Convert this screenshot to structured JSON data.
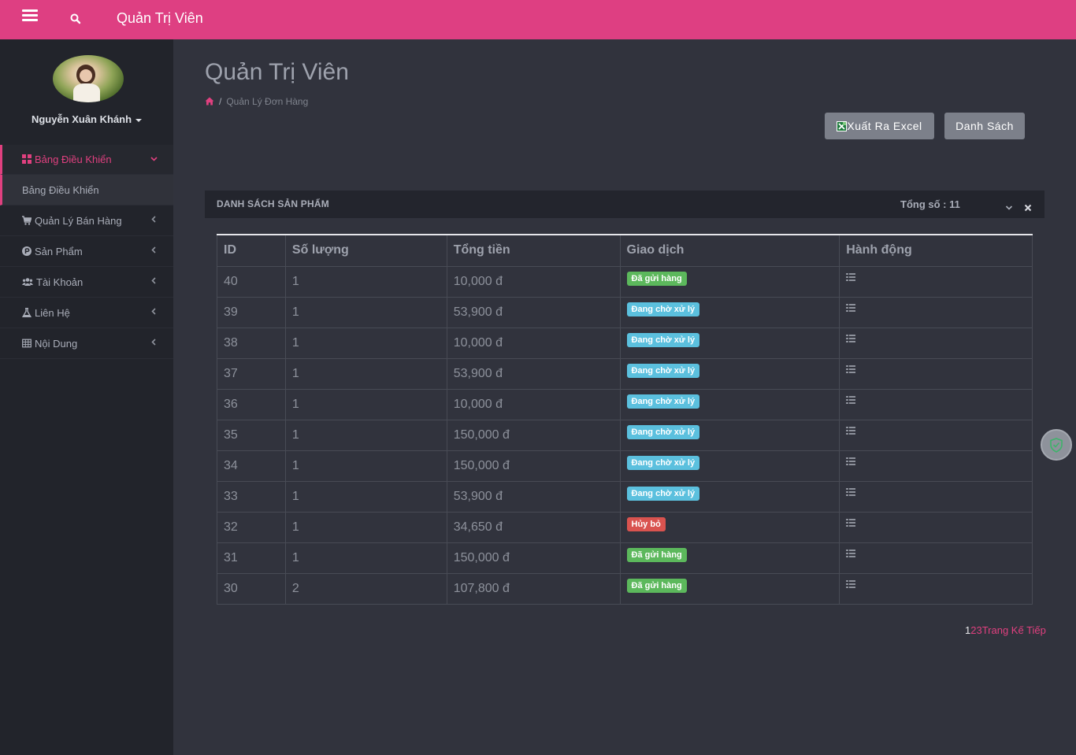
{
  "topbar": {
    "brand": "Quản Trị Viên",
    "menu_icon": "bars-icon",
    "search_icon": "search-icon",
    "color": "#de3f82"
  },
  "sidebar": {
    "username": "Nguyễn Xuân Khánh",
    "items": [
      {
        "label": "Bảng Điều Khiển",
        "icon": "th-large-icon",
        "active": true
      },
      {
        "label": "Bảng Điều Khiển",
        "sub": true
      },
      {
        "label": "Quản Lý Bán Hàng",
        "icon": "cart-icon"
      },
      {
        "label": "Sản Phẩm",
        "icon": "product-hunt-icon"
      },
      {
        "label": "Tài Khoản",
        "icon": "users-icon"
      },
      {
        "label": "Liên Hệ",
        "icon": "flask-icon"
      },
      {
        "label": "Nội Dung",
        "icon": "table-icon"
      }
    ]
  },
  "main": {
    "title": "Quản Trị Viên",
    "breadcrumb": {
      "separator": "/",
      "current": "Quản Lý Đơn Hàng"
    },
    "buttons": {
      "excel": "Xuất Ra Excel",
      "list": "Danh Sách"
    },
    "panel": {
      "title": "DANH SÁCH SẢN PHẨM",
      "total": "Tổng số : 11"
    },
    "table": {
      "headers": [
        "ID",
        "Số lượng",
        "Tổng tiền",
        "Giao dịch",
        "Hành động"
      ],
      "rows": [
        {
          "id": "40",
          "qty": "1",
          "total": "10,000 đ",
          "status": "Đã gửi hàng",
          "status_type": "sent"
        },
        {
          "id": "39",
          "qty": "1",
          "total": "53,900 đ",
          "status": "Đang chờ xử lý",
          "status_type": "wait"
        },
        {
          "id": "38",
          "qty": "1",
          "total": "10,000 đ",
          "status": "Đang chờ xử lý",
          "status_type": "wait"
        },
        {
          "id": "37",
          "qty": "1",
          "total": "53,900 đ",
          "status": "Đang chờ xử lý",
          "status_type": "wait"
        },
        {
          "id": "36",
          "qty": "1",
          "total": "10,000 đ",
          "status": "Đang chờ xử lý",
          "status_type": "wait"
        },
        {
          "id": "35",
          "qty": "1",
          "total": "150,000 đ",
          "status": "Đang chờ xử lý",
          "status_type": "wait"
        },
        {
          "id": "34",
          "qty": "1",
          "total": "150,000 đ",
          "status": "Đang chờ xử lý",
          "status_type": "wait"
        },
        {
          "id": "33",
          "qty": "1",
          "total": "53,900 đ",
          "status": "Đang chờ xử lý",
          "status_type": "wait"
        },
        {
          "id": "32",
          "qty": "1",
          "total": "34,650 đ",
          "status": "Hủy bỏ",
          "status_type": "cancel"
        },
        {
          "id": "31",
          "qty": "1",
          "total": "150,000 đ",
          "status": "Đã gửi hàng",
          "status_type": "sent"
        },
        {
          "id": "30",
          "qty": "2",
          "total": "107,800 đ",
          "status": "Đã gửi hàng",
          "status_type": "sent"
        }
      ]
    },
    "pagination": {
      "pages": [
        "1",
        "2",
        "3"
      ],
      "next": "Trang Kế Tiếp"
    }
  }
}
